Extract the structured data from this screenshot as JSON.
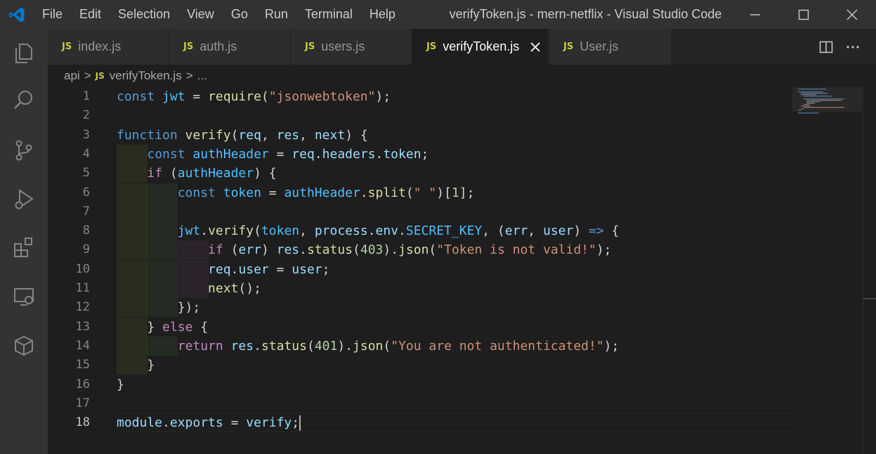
{
  "window": {
    "title": "verifyToken.js - mern-netflix - Visual Studio Code",
    "menu": [
      "File",
      "Edit",
      "Selection",
      "View",
      "Go",
      "Run",
      "Terminal",
      "Help"
    ]
  },
  "activity_bar": [
    "explorer-icon",
    "search-icon",
    "source-control-icon",
    "run-debug-icon",
    "extensions-icon",
    "remote-explorer-icon",
    "docker-icon"
  ],
  "tabs": [
    {
      "badge": "JS",
      "label": "index.js",
      "active": false
    },
    {
      "badge": "JS",
      "label": "auth.js",
      "active": false
    },
    {
      "badge": "JS",
      "label": "users.js",
      "active": false
    },
    {
      "badge": "JS",
      "label": "verifyToken.js",
      "active": true
    },
    {
      "badge": "JS",
      "label": "User.js",
      "active": false
    }
  ],
  "breadcrumb": {
    "folder": "api",
    "sep1": ">",
    "badge": "JS",
    "file": "verifyToken.js",
    "sep2": ">",
    "symbol": "..."
  },
  "editor": {
    "active_line": 18,
    "line_numbers": [
      "1",
      "2",
      "3",
      "4",
      "5",
      "6",
      "7",
      "8",
      "9",
      "10",
      "11",
      "12",
      "13",
      "14",
      "15",
      "16",
      "17",
      "18"
    ],
    "lines": [
      [
        [
          "kw",
          "const"
        ],
        [
          "pl",
          " "
        ],
        [
          "cst",
          "jwt"
        ],
        [
          "pl",
          " = "
        ],
        [
          "fn",
          "require"
        ],
        [
          "pl",
          "("
        ],
        [
          "str",
          "\"jsonwebtoken\""
        ],
        [
          "pl",
          ");"
        ]
      ],
      [],
      [
        [
          "kw",
          "function"
        ],
        [
          "pl",
          " "
        ],
        [
          "fn",
          "verify"
        ],
        [
          "pl",
          "("
        ],
        [
          "var",
          "req"
        ],
        [
          "pl",
          ", "
        ],
        [
          "var",
          "res"
        ],
        [
          "pl",
          ", "
        ],
        [
          "var",
          "next"
        ],
        [
          "pl",
          ") {"
        ]
      ],
      [
        [
          "pl",
          "    "
        ],
        [
          "kw",
          "const"
        ],
        [
          "pl",
          " "
        ],
        [
          "cst",
          "authHeader"
        ],
        [
          "pl",
          " = "
        ],
        [
          "var",
          "req"
        ],
        [
          "pl",
          "."
        ],
        [
          "var",
          "headers"
        ],
        [
          "pl",
          "."
        ],
        [
          "var",
          "token"
        ],
        [
          "pl",
          ";"
        ]
      ],
      [
        [
          "pl",
          "    "
        ],
        [
          "ctl",
          "if"
        ],
        [
          "pl",
          " ("
        ],
        [
          "cst",
          "authHeader"
        ],
        [
          "pl",
          ") {"
        ]
      ],
      [
        [
          "pl",
          "        "
        ],
        [
          "kw",
          "const"
        ],
        [
          "pl",
          " "
        ],
        [
          "cst",
          "token"
        ],
        [
          "pl",
          " = "
        ],
        [
          "cst",
          "authHeader"
        ],
        [
          "pl",
          "."
        ],
        [
          "fn",
          "split"
        ],
        [
          "pl",
          "("
        ],
        [
          "str",
          "\" \""
        ],
        [
          "pl",
          ")["
        ],
        [
          "num",
          "1"
        ],
        [
          "pl",
          "];"
        ]
      ],
      [],
      [
        [
          "pl",
          "        "
        ],
        [
          "cst",
          "jwt"
        ],
        [
          "pl",
          "."
        ],
        [
          "fn",
          "verify"
        ],
        [
          "pl",
          "("
        ],
        [
          "cst",
          "token"
        ],
        [
          "pl",
          ", "
        ],
        [
          "var",
          "process"
        ],
        [
          "pl",
          "."
        ],
        [
          "var",
          "env"
        ],
        [
          "pl",
          "."
        ],
        [
          "cst",
          "SECRET_KEY"
        ],
        [
          "pl",
          ", ("
        ],
        [
          "var",
          "err"
        ],
        [
          "pl",
          ", "
        ],
        [
          "var",
          "user"
        ],
        [
          "pl",
          ") "
        ],
        [
          "kw",
          "=>"
        ],
        [
          "pl",
          " {"
        ]
      ],
      [
        [
          "pl",
          "            "
        ],
        [
          "ctl",
          "if"
        ],
        [
          "pl",
          " ("
        ],
        [
          "var",
          "err"
        ],
        [
          "pl",
          ") "
        ],
        [
          "var",
          "res"
        ],
        [
          "pl",
          "."
        ],
        [
          "fn",
          "status"
        ],
        [
          "pl",
          "("
        ],
        [
          "num",
          "403"
        ],
        [
          "pl",
          ")."
        ],
        [
          "fn",
          "json"
        ],
        [
          "pl",
          "("
        ],
        [
          "str",
          "\"Token is not valid!\""
        ],
        [
          "pl",
          ");"
        ]
      ],
      [
        [
          "pl",
          "            "
        ],
        [
          "var",
          "req"
        ],
        [
          "pl",
          "."
        ],
        [
          "var",
          "user"
        ],
        [
          "pl",
          " = "
        ],
        [
          "var",
          "user"
        ],
        [
          "pl",
          ";"
        ]
      ],
      [
        [
          "pl",
          "            "
        ],
        [
          "fn",
          "next"
        ],
        [
          "pl",
          "();"
        ]
      ],
      [
        [
          "pl",
          "        });"
        ]
      ],
      [
        [
          "pl",
          "    } "
        ],
        [
          "ctl",
          "else"
        ],
        [
          "pl",
          " {"
        ]
      ],
      [
        [
          "pl",
          "        "
        ],
        [
          "ctl",
          "return"
        ],
        [
          "pl",
          " "
        ],
        [
          "var",
          "res"
        ],
        [
          "pl",
          "."
        ],
        [
          "fn",
          "status"
        ],
        [
          "pl",
          "("
        ],
        [
          "num",
          "401"
        ],
        [
          "pl",
          ")."
        ],
        [
          "fn",
          "json"
        ],
        [
          "pl",
          "("
        ],
        [
          "str",
          "\"You are not authenticated!\""
        ],
        [
          "pl",
          ");"
        ]
      ],
      [
        [
          "pl",
          "    }"
        ]
      ],
      [
        [
          "pl",
          "}"
        ]
      ],
      [],
      [
        [
          "var",
          "module"
        ],
        [
          "pl",
          "."
        ],
        [
          "var",
          "exports"
        ],
        [
          "pl",
          " = "
        ],
        [
          "var",
          "verify"
        ],
        [
          "pl",
          ";"
        ]
      ]
    ]
  },
  "colors": {
    "keyword": "#569cd6",
    "control": "#c586c0",
    "function": "#dcdcaa",
    "variable": "#9cdcfe",
    "constant": "#4fc1ff",
    "string": "#ce9178",
    "number": "#b5cea8",
    "js_badge": "#cbcb41",
    "vscode_blue": "#0078d4"
  }
}
